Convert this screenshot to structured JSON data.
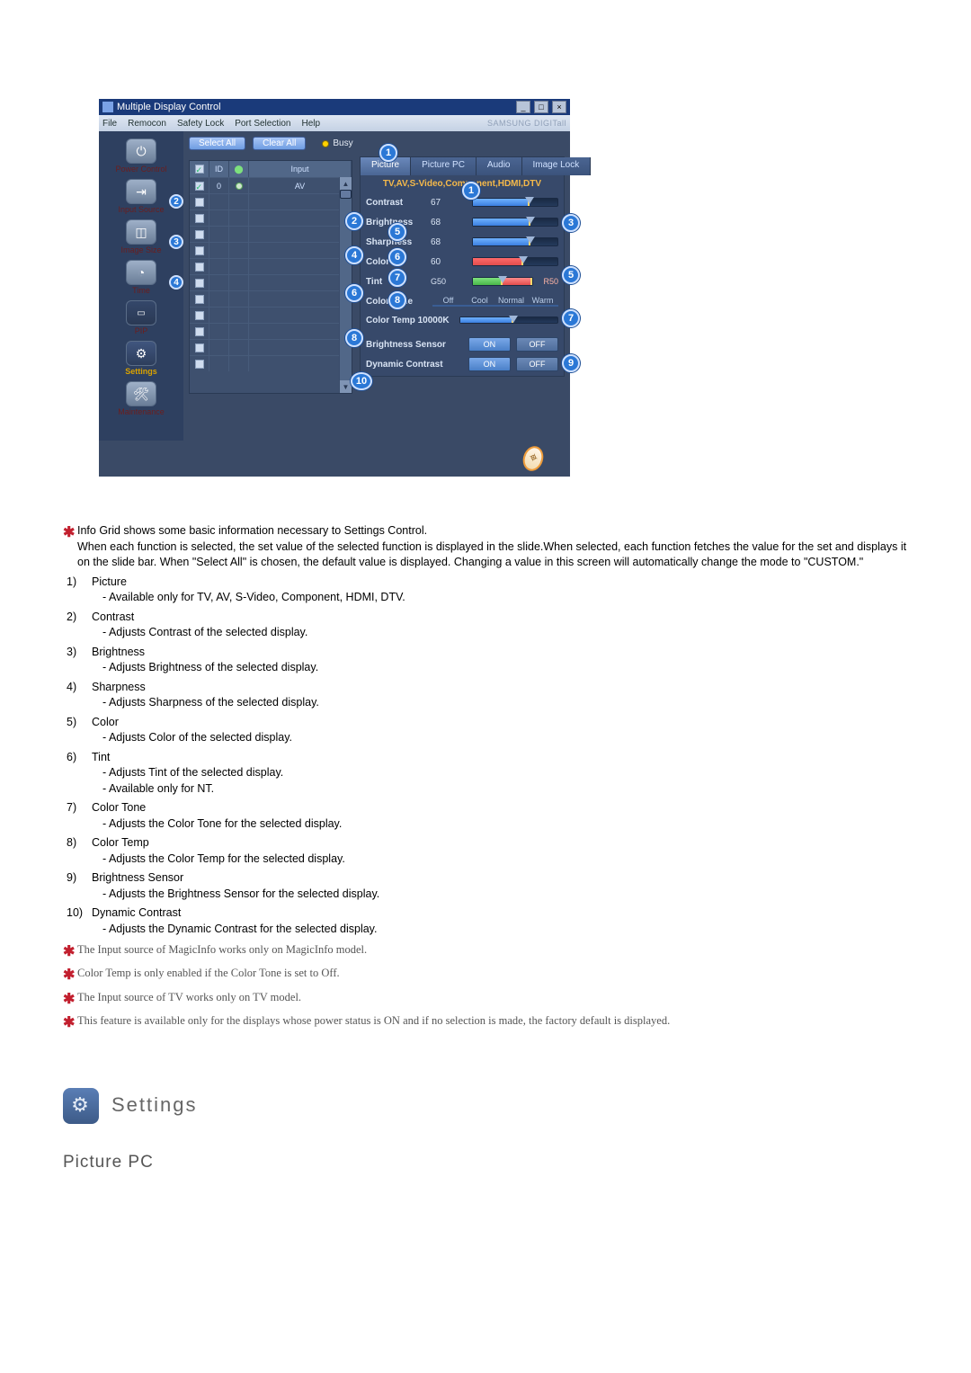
{
  "window": {
    "title": "Multiple Display Control",
    "brand": "SAMSUNG DIGITall",
    "menu": [
      "File",
      "Remocon",
      "Safety Lock",
      "Port Selection",
      "Help"
    ]
  },
  "sidebar": {
    "items": [
      {
        "label": "Power Control"
      },
      {
        "label": "Input Source",
        "badge": "2"
      },
      {
        "label": "Image Size",
        "badge": "3"
      },
      {
        "label": "Time",
        "badge": "4"
      },
      {
        "label": "PIP"
      },
      {
        "label": "Settings"
      },
      {
        "label": "Maintenance"
      }
    ]
  },
  "toolbar": {
    "select_all": "Select All",
    "clear_all": "Clear All",
    "busy": "Busy"
  },
  "grid": {
    "headers": {
      "id": "ID",
      "input": "Input",
      "input_value": "AV"
    },
    "first_id": "0"
  },
  "tabs": {
    "t1": "Picture",
    "t2": "Picture PC",
    "t3": "Audio",
    "t4": "Image Lock"
  },
  "sub_note": "TV,AV,S-Video,Component,HDMI,DTV",
  "sliders": {
    "contrast": {
      "label": "Contrast",
      "value": "67"
    },
    "brightness": {
      "label": "Brightness",
      "value": "68"
    },
    "sharpness": {
      "label": "Sharpness",
      "value": "68"
    },
    "color": {
      "label": "Color",
      "value": "60"
    },
    "tint": {
      "label": "Tint",
      "left": "G50",
      "right": "R50"
    }
  },
  "color_tone": {
    "label": "Color Tone",
    "opts": [
      "Off",
      "Cool",
      "Normal",
      "Warm"
    ]
  },
  "color_temp": {
    "label": "Color Temp",
    "value": "10000K"
  },
  "brightness_sensor": {
    "label": "Brightness Sensor",
    "on": "ON",
    "off": "OFF"
  },
  "dynamic_contrast": {
    "label": "Dynamic Contrast",
    "on": "ON",
    "off": "OFF"
  },
  "callouts": {
    "c1": "1",
    "c2": "2",
    "c3": "3",
    "c4": "4",
    "c5": "5",
    "c5b": "5",
    "c6": "6",
    "c6b": "6",
    "c7": "7",
    "c7b": "7",
    "c8": "8",
    "c8b": "8",
    "c9": "9",
    "c10": "10"
  },
  "desc_intro": "Info Grid shows some basic information necessary to Settings Control.\nWhen each function is selected, the set value of the selected function is displayed in the slide.When selected, each function fetches the value for the set and displays it on the slide bar. When \"Select All\" is chosen, the default value is displayed. Changing a value in this screen will automatically change the mode to \"CUSTOM.\"",
  "items": [
    {
      "n": "1)",
      "title": "Picture",
      "subs": [
        "- Available only for TV, AV, S-Video, Component, HDMI, DTV."
      ]
    },
    {
      "n": "2)",
      "title": "Contrast",
      "subs": [
        "- Adjusts Contrast of the selected display."
      ]
    },
    {
      "n": "3)",
      "title": "Brightness",
      "subs": [
        "- Adjusts Brightness of the selected display."
      ]
    },
    {
      "n": "4)",
      "title": "Sharpness",
      "subs": [
        "- Adjusts Sharpness of the selected display."
      ]
    },
    {
      "n": "5)",
      "title": "Color",
      "subs": [
        "- Adjusts Color of the selected display."
      ]
    },
    {
      "n": "6)",
      "title": "Tint",
      "subs": [
        "- Adjusts Tint of the selected display.",
        "- Available  only for NT."
      ]
    },
    {
      "n": "7)",
      "title": "Color Tone",
      "subs": [
        "- Adjusts the Color Tone for the selected display."
      ]
    },
    {
      "n": "8)",
      "title": "Color Temp",
      "subs": [
        "- Adjusts the Color Temp for the selected display."
      ]
    },
    {
      "n": "9)",
      "title": "Brightness Sensor",
      "subs": [
        "- Adjusts the Brightness Sensor for the selected display."
      ]
    },
    {
      "n": "10)",
      "title": "Dynamic Contrast",
      "subs": [
        "- Adjusts the Dynamic Contrast for the selected display."
      ]
    }
  ],
  "notes": [
    "The Input source of MagicInfo works only on MagicInfo model.",
    "Color Temp is only enabled if the Color Tone is set to Off.",
    "The Input source of TV works only on TV model.",
    "This feature is available only for the displays whose power status is ON and if no selection is made, the factory default is displayed."
  ],
  "section_title": "Settings",
  "sub_section": "Picture PC"
}
